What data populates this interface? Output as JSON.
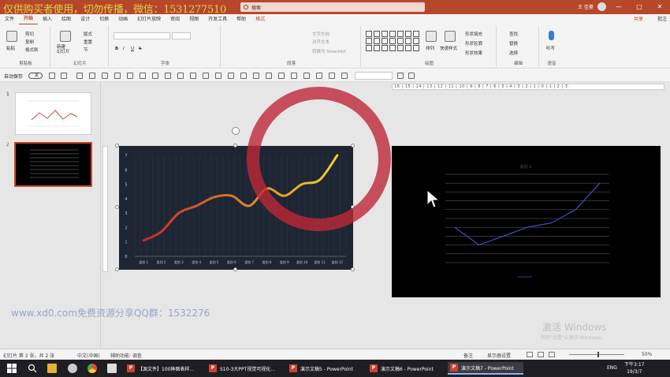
{
  "titlebar": {
    "watermark": "仅供购买者使用，切勿传播，微信：1531277510",
    "search_placeholder": "搜索",
    "user": "王 佳豪",
    "minimize": "—",
    "restore": "□",
    "close": "✕"
  },
  "tabs": [
    "文件",
    "开始",
    "插入",
    "绘图",
    "设计",
    "切换",
    "动画",
    "幻灯片放映",
    "审阅",
    "视图",
    "开发工具",
    "帮助",
    "格式"
  ],
  "share": "共享",
  "comment": "批注",
  "ribbon": {
    "clipboard": {
      "paste": "粘贴",
      "cut": "剪切",
      "copy": "复制",
      "format_painter": "格式刷",
      "label": "剪贴板"
    },
    "slides": {
      "new_slide": "新建\n幻灯片",
      "layout": "版式",
      "reset": "重置",
      "section": "节",
      "label": "幻灯片"
    },
    "font": {
      "label": "字体",
      "bold": "B",
      "italic": "I",
      "underline": "U",
      "strike": "S"
    },
    "paragraph": {
      "label": "段落",
      "text_direction": "文字方向",
      "align_text": "对齐文本",
      "smartart": "转换为 SmartArt"
    },
    "drawing": {
      "arrange": "排列",
      "quick_styles": "快速样式",
      "shape_fill": "形状填充",
      "shape_outline": "形状轮廓",
      "shape_effects": "形状效果",
      "label": "绘图"
    },
    "editing": {
      "find": "查找",
      "replace": "替换",
      "select": "选择",
      "label": "编辑"
    },
    "voice": {
      "dictate": "听写",
      "label": "语音"
    }
  },
  "qat": {
    "autosave": "自动保存",
    "autosave_state": "关"
  },
  "ruler_text": "·16·|·15·|·14·|·13·|·12·|·11·|·10·|·9·|·8·|·7·|·6·|·5·|·4·|·3·|·2·|·1·|·0·|·1·|·2·|·3·",
  "thumbnails": [
    {
      "number": "1"
    },
    {
      "number": "2"
    }
  ],
  "chart_data": [
    {
      "type": "line",
      "categories": [
        "类别 1",
        "类别 2",
        "类别 3",
        "类别 4",
        "类别 5",
        "类别 6",
        "类别 7",
        "类别 8",
        "类别 9",
        "类别 10",
        "类别 11",
        "类别 12"
      ],
      "yticks": [
        "0",
        "1",
        "2",
        "3",
        "4",
        "5",
        "6",
        "7"
      ],
      "ylim": [
        0,
        7
      ],
      "series": [
        {
          "values": [
            1.1,
            1.7,
            3.0,
            3.5,
            4.1,
            4.2,
            3.5,
            4.7,
            4.2,
            5.0,
            5.3,
            7.0
          ]
        }
      ],
      "grid": "vertical",
      "colors": {
        "start": "#c62a2a",
        "end": "#f6d12e",
        "background": "#1e2633"
      }
    },
    {
      "type": "line",
      "title": "系列 1",
      "categories": [
        "",
        "",
        "",
        "",
        "",
        "",
        ""
      ],
      "ylim": [
        0,
        10
      ],
      "series": [
        {
          "values": [
            4.0,
            2.0,
            3.0,
            4.0,
            4.5,
            6.0,
            9.0
          ]
        }
      ],
      "grid": "horizontal",
      "colors": {
        "line": "#4a4ad0",
        "background": "#000000"
      }
    }
  ],
  "watermark_bottom": "www.xd0.com免费资源分享QQ群：1532276",
  "activate": {
    "line1": "激活 Windows",
    "line2": "转到\"设置\"以激活 Windows。"
  },
  "statusbar": {
    "slide_info": "幻灯片 第 2 张，共 2 张",
    "language": "中文(中国)",
    "accessibility": "辅助功能: 调查",
    "notes": "备注",
    "display": "显示器设置",
    "zoom": "50%"
  },
  "taskbar": {
    "tasks": [
      "【源文件】100种图表样...",
      "S10-3大PPT视觉可视化...",
      "演示文稿5 - PowerPoint",
      "演示文稿6 - PowerPoint",
      "演示文稿7 - PowerPoint"
    ],
    "lang": "ENG",
    "time": "下午3:17",
    "date": "19/3/7"
  }
}
